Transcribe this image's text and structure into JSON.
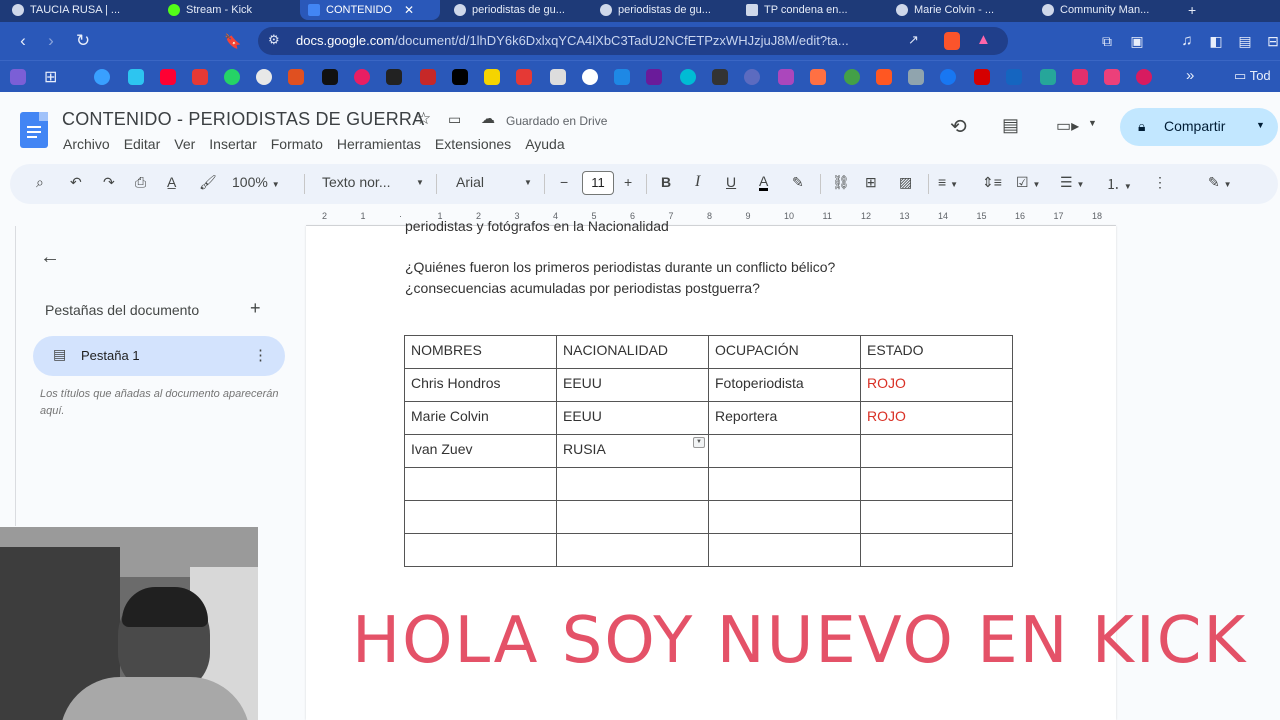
{
  "browser": {
    "tabs": [
      {
        "title": "TAUCIA RUSA | ..."
      },
      {
        "title": "Stream - Kick"
      },
      {
        "title": "CONTENIDO",
        "active": true
      },
      {
        "title": "periodistas de gu..."
      },
      {
        "title": "periodistas de gu..."
      },
      {
        "title": "TP condena en..."
      },
      {
        "title": "Marie Colvin - ..."
      },
      {
        "title": "Community Man..."
      }
    ],
    "url_host": "docs.google.com",
    "url_path": "/document/d/1lhDY6k6DxlxqYCA4lXbC3TadU2NCfETPzxWHJzjuJ8M/edit?ta...",
    "bookmarks_more": "»",
    "bookmarks_all": "Tod"
  },
  "doc": {
    "title": "CONTENIDO - PERIODISTAS DE GUERRA",
    "saved_status": "Guardado en Drive",
    "menus": [
      "Archivo",
      "Editar",
      "Ver",
      "Insertar",
      "Formato",
      "Herramientas",
      "Extensiones",
      "Ayuda"
    ],
    "share_label": "Compartir"
  },
  "toolbar": {
    "zoom": "100%",
    "style": "Texto nor...",
    "font": "Arial",
    "font_size": "11",
    "minus": "−",
    "plus": "+"
  },
  "sidebar": {
    "heading": "Pestañas del documento",
    "add": "+",
    "tab_label": "Pestaña 1",
    "hint": "Los títulos que añadas al documento aparecerán aquí."
  },
  "page": {
    "cut_line": "periodistas y fotógrafos en la Nacionalidad",
    "questions": [
      "¿Quiénes fueron los primeros periodistas durante un conflicto bélico?",
      "¿consecuencias acumuladas por periodistas postguerra?"
    ],
    "table": {
      "headers": [
        "NOMBRES",
        "NACIONALIDAD",
        "OCUPACIÓN",
        "ESTADO"
      ],
      "rows": [
        [
          "Chris Hondros",
          "EEUU",
          "Fotoperiodista",
          "ROJO"
        ],
        [
          "Marie Colvin",
          "EEUU",
          "Reportera",
          "ROJO"
        ],
        [
          "Ivan Zuev",
          "RUSIA",
          "",
          ""
        ],
        [
          "",
          "",
          "",
          ""
        ],
        [
          "",
          "",
          "",
          ""
        ],
        [
          "",
          "",
          "",
          ""
        ]
      ],
      "status_color": "#d93025"
    }
  },
  "overlay": {
    "text": "HOLA SOY NUEVO EN KICK",
    "color": "#e0344e"
  },
  "ruler_ticks": [
    "2",
    "1",
    "",
    "1",
    "2",
    "3",
    "4",
    "5",
    "6",
    "7",
    "8",
    "9",
    "10",
    "11",
    "12",
    "13",
    "14",
    "15",
    "16",
    "17",
    "18"
  ],
  "colors": {
    "docs_blue": "#4285f4",
    "share_bg": "#c2e7ff",
    "chrome_blue": "#2a58b9"
  }
}
